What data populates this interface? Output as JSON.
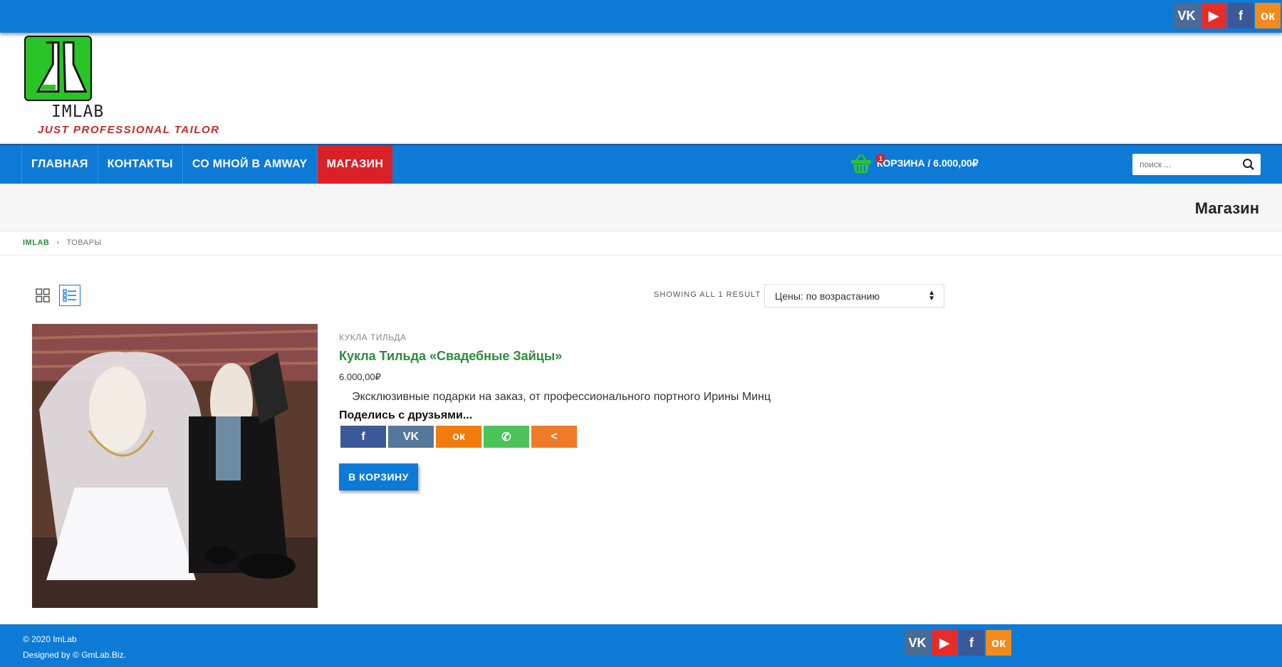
{
  "colors": {
    "brand_blue": "#0d7ad6",
    "active_red": "#d92027",
    "link_green": "#2e8b3a"
  },
  "top_social": [
    {
      "name": "vk-icon",
      "label": "VK"
    },
    {
      "name": "youtube-icon",
      "label": "▶"
    },
    {
      "name": "facebook-icon",
      "label": "f"
    },
    {
      "name": "odnoklassniki-icon",
      "label": "ок"
    }
  ],
  "header": {
    "brand": "IMLAB",
    "tagline": "JUST PROFESSIONAL TAILOR"
  },
  "nav": {
    "items": [
      "ГЛАВНАЯ",
      "КОНТАКТЫ",
      "СО МНОЙ В AMWAY",
      "МАГАЗИН"
    ],
    "active": "МАГАЗИН"
  },
  "cart": {
    "count": "1",
    "label": "КОРЗИНА / 6.000,00₽"
  },
  "search": {
    "placeholder": "поиск ..."
  },
  "page": {
    "title": "Магазин"
  },
  "breadcrumb": {
    "home": "IMLAB",
    "separator": "›",
    "current": "ТОВАРЫ"
  },
  "toolbar": {
    "result_count": "SHOWING ALL 1 RESULT",
    "sort_value": "Цены: по возрастанию",
    "arrow_up": "▲",
    "arrow_down": "▼"
  },
  "product": {
    "category": "КУКЛА ТИЛЬДА",
    "name": "Кукла Тильда «Свадебные Зайцы»",
    "price": "6.000,00₽",
    "description": "Эксклюзивные подарки на заказ, от профессионального портного Ирины Минц",
    "share_title": "Поделись с друзьями...",
    "share_buttons": [
      {
        "name": "share-facebook-button",
        "label": "f"
      },
      {
        "name": "share-vk-button",
        "label": "VK"
      },
      {
        "name": "share-odnoklassniki-button",
        "label": "ок"
      },
      {
        "name": "share-whatsapp-button",
        "label": "✆"
      },
      {
        "name": "share-more-button",
        "label": "<"
      }
    ],
    "add_to_cart": "В КОРЗИНУ"
  },
  "footer": {
    "copyright": "© 2020 ImLab",
    "designed_by": "Designed by © GmLab.Biz."
  }
}
